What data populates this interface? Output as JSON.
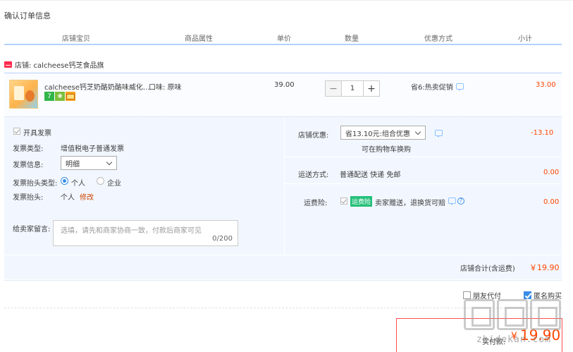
{
  "page": {
    "title": "确认订单信息"
  },
  "columns": [
    "店铺宝贝",
    "商品属性",
    "单价",
    "数量",
    "优惠方式",
    "小计"
  ],
  "shop": {
    "label": "店铺: calcheese钙芝食品旗"
  },
  "item": {
    "name": "calcheese钙芝奶酪奶酪味威化...",
    "attr": "口味: 原味",
    "unit_price": "39.00",
    "quantity": "1",
    "promo": "省6:热卖促销",
    "subtotal": "33.00",
    "badge_1": "7"
  },
  "invoice": {
    "open_label": "开具发票",
    "type_label": "发票类型:",
    "type_value": "增值税电子普通发票",
    "info_label": "发票信息:",
    "info_value": "明细",
    "header_type_label": "发票抬头类型:",
    "radio_personal": "个人",
    "radio_company": "企业",
    "header_label": "发票抬头:",
    "header_value": "个人",
    "modify": "修改"
  },
  "message": {
    "label": "给卖家留言:",
    "placeholder": "选填，请先和商家协商一致，付款后商家可见",
    "count": "0/200"
  },
  "shop_discount": {
    "label": "店铺优惠:",
    "selected": "省13.10元:组合优惠",
    "note": "可在购物车换购",
    "value": "-13.10"
  },
  "shipping": {
    "label": "运送方式:",
    "desc": "普通配送 快递 免邮",
    "value": "0.00"
  },
  "insurance": {
    "label": "运费险:",
    "tag": "运费险",
    "desc": "卖家赠送，退换货可赔",
    "value": "0.00",
    "help": "?"
  },
  "total": {
    "label": "店铺合计(含运费)",
    "value": "￥19.90"
  },
  "options": {
    "friend_pay": "朋友代付",
    "anonymous": "匿名购买"
  },
  "payment": {
    "label": "实付款:",
    "sign": "¥",
    "value": "19.90"
  },
  "watermark": {
    "text": "zhidekan.com"
  }
}
